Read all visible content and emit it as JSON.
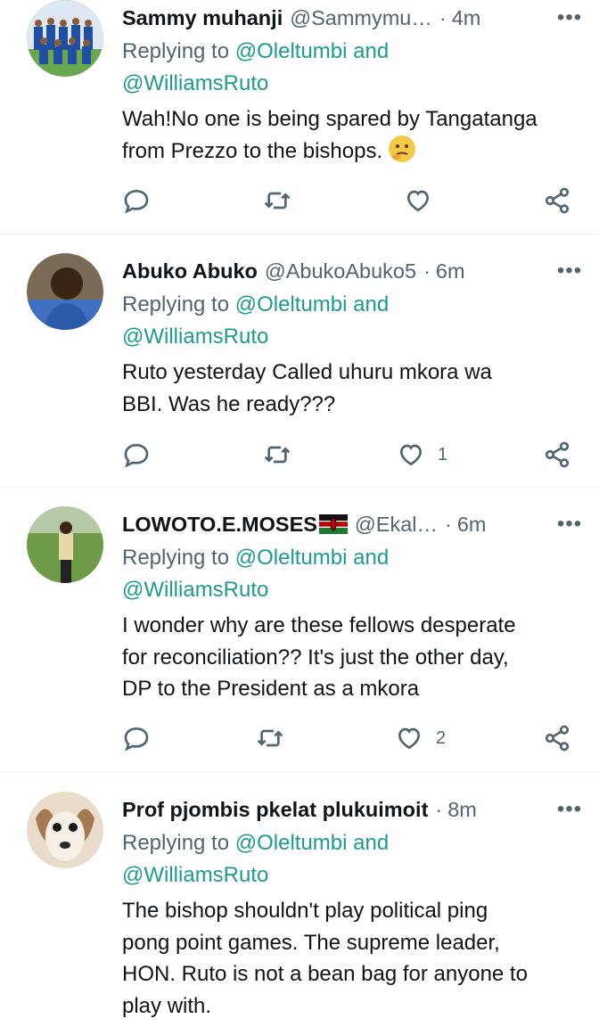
{
  "tweets": [
    {
      "name": "Sammy muhanji",
      "handle": "@Sammymu…",
      "time": "4m",
      "reply_prefix": "Replying to ",
      "mention1": "@Oleltumbi",
      "and": " and",
      "mention2": "@WilliamsRuto",
      "text": "Wah!No one is being spared by Tangatanga\nfrom Prezzo to the bishops.",
      "emoji": "thinking-face",
      "likes": ""
    },
    {
      "name": "Abuko Abuko",
      "handle": "@AbukoAbuko5",
      "time": "6m",
      "reply_prefix": "Replying to ",
      "mention1": "@Oleltumbi",
      "and": " and",
      "mention2": "@WilliamsRuto",
      "text": "Ruto yesterday Called uhuru mkora wa\nBBI. Was he ready???",
      "likes": "1"
    },
    {
      "name": "LOWOTO.E.MOSES",
      "flag": "kenya-flag",
      "handle": "@Ekal…",
      "time": "6m",
      "reply_prefix": "Replying to ",
      "mention1": "@Oleltumbi",
      "and": " and",
      "mention2": "@WilliamsRuto",
      "text": "I wonder why are these fellows desperate\nfor reconciliation?? It's just the other day,\nDP to the President as a mkora",
      "likes": "2"
    },
    {
      "name": "Prof pjombis pkelat plukuimoit",
      "handle": "",
      "time": "8m",
      "reply_prefix": "Replying to ",
      "mention1": "@Oleltumbi",
      "and": " and",
      "mention2": "@WilliamsRuto",
      "text": "The bishop shouldn't play political ping\npong point games. The supreme leader,\nHON. Ruto is not a bean bag for anyone to\nplay with.",
      "likes": ""
    }
  ],
  "separator": "·",
  "colors": {
    "mention": "#1d9b8f",
    "secondary": "#536471",
    "text": "#0f1419"
  }
}
